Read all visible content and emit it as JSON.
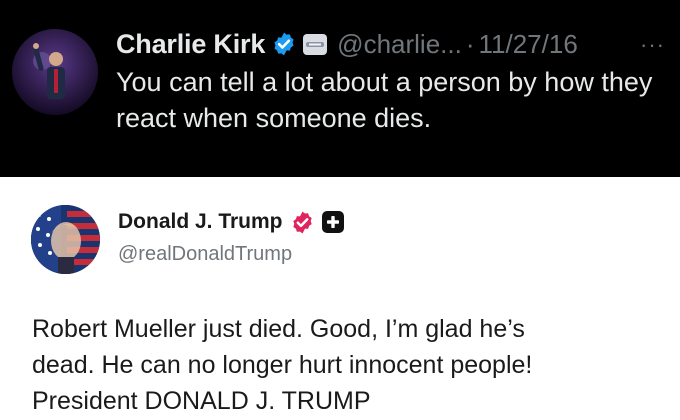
{
  "top_post": {
    "author_name": "Charlie Kirk",
    "handle": "@charlie...",
    "separator": "·",
    "date": "11/27/16",
    "more_label": "···",
    "text": "You can tell a lot about a person by how they react when someone dies.",
    "verified_badge_color": "#1d9bf0",
    "background_color": "#000000"
  },
  "bottom_post": {
    "author_name": "Donald J. Trump",
    "handle": "@realDonaldTrump",
    "verified_badge_color": "#e0245e",
    "text_lines": [
      "Robert Mueller just died. Good, I’m glad he’s",
      "dead. He can no longer hurt innocent people!",
      "President DONALD J. TRUMP"
    ]
  }
}
